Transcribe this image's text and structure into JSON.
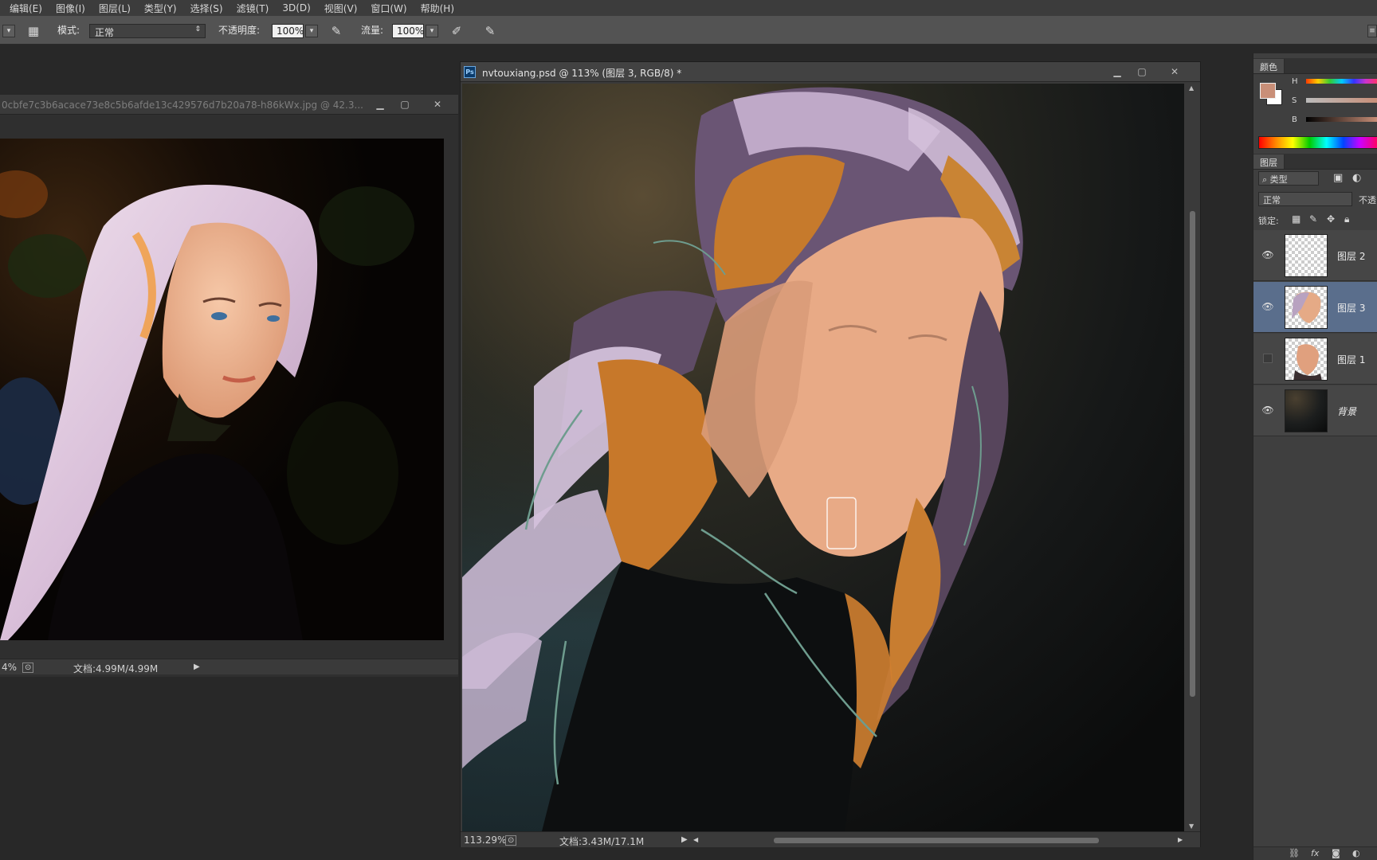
{
  "menu": [
    "编辑(E)",
    "图像(I)",
    "图层(L)",
    "类型(Y)",
    "选择(S)",
    "滤镜(T)",
    "3D(D)",
    "视图(V)",
    "窗口(W)",
    "帮助(H)"
  ],
  "options": {
    "mode_label": "模式:",
    "mode_value": "正常",
    "opacity_label": "不透明度:",
    "opacity_value": "100%",
    "flow_label": "流量:",
    "flow_value": "100%"
  },
  "doc_ref": {
    "title": "0cbfe7c3b6acace73e8c5b6afde13c429576d7b20a78-h86kWx.jpg @ 42.3...",
    "zoom": "4%",
    "doc_size": "文档:4.99M/4.99M"
  },
  "doc_main": {
    "title": "nvtouxiang.psd @ 113% (图层 3, RGB/8) *",
    "zoom": "113.29%",
    "doc_size": "文档:3.43M/17.1M"
  },
  "color_panel": {
    "tab": "颜色",
    "h_label": "H",
    "s_label": "S",
    "b_label": "B",
    "fg_color": "#c98f78",
    "bg_color": "#ffffff"
  },
  "layers_panel": {
    "tab": "图层",
    "filter_label": "类型",
    "blend_mode": "正常",
    "opacity_label": "不透",
    "lock_label": "锁定:",
    "layers": [
      {
        "name": "图层 2",
        "visible": true,
        "selected": false
      },
      {
        "name": "图层 3",
        "visible": true,
        "selected": true
      },
      {
        "name": "图层 1",
        "visible": false,
        "selected": false
      },
      {
        "name": "背景",
        "visible": true,
        "selected": false
      }
    ]
  }
}
